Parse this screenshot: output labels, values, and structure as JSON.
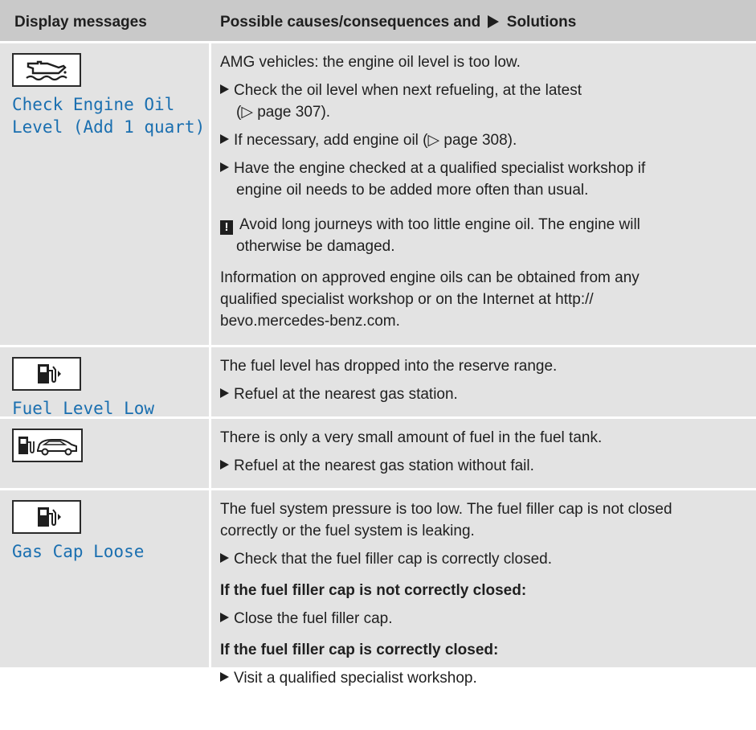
{
  "header": {
    "col1": "Display messages",
    "col2_a": "Possible causes/consequences and",
    "col2_b": "Solutions"
  },
  "rows": [
    {
      "icon": "oil-can-icon",
      "message_line1": "Check Engine Oil",
      "message_line2": "Level (Add 1 quart)",
      "intro": "AMG vehicles: the engine oil level is too low.",
      "step1_line1": "Check the oil level when next refueling, at the latest",
      "step1_line2": "(▷ page 307).",
      "step2": "If necessary, add engine oil (▷ page 308).",
      "step3_line1": "Have the engine checked at a qualified specialist workshop if",
      "step3_line2": "engine oil needs to be added more often than usual.",
      "warning_line1": "Avoid long journeys with too little engine oil. The engine will",
      "warning_line2": "otherwise be damaged.",
      "info_line1": "Information on approved engine oils can be obtained from any",
      "info_line2": "qualified specialist workshop or on the Internet at http://",
      "info_line3": "bevo.mercedes-benz.com."
    },
    {
      "icon": "fuel-pump-icon",
      "message": "Fuel Level Low",
      "text": "The fuel level has dropped into the reserve range.",
      "step": "Refuel at the nearest gas station."
    },
    {
      "icon": "fuel-pump-car-icon",
      "text": "There is only a very small amount of fuel in the fuel tank.",
      "step": "Refuel at the nearest gas station without fail."
    },
    {
      "icon": "fuel-pump-icon",
      "message": "Gas Cap Loose",
      "text_line1": "The fuel system pressure is too low. The fuel filler cap is not closed",
      "text_line2": "correctly or the fuel system is leaking.",
      "step1": "Check that the fuel filler cap is correctly closed.",
      "cond1": "If the fuel filler cap is not correctly closed:",
      "step2": "Close the fuel filler cap.",
      "cond2": "If the fuel filler cap is correctly closed:",
      "step3": "Visit a qualified specialist workshop."
    }
  ]
}
